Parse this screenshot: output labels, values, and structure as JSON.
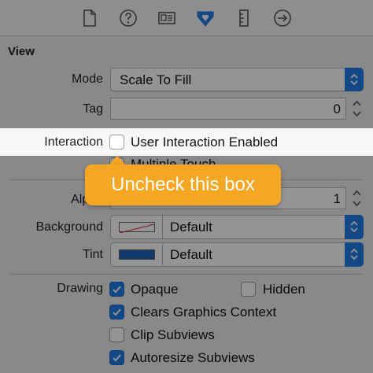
{
  "toolbar": {
    "icons": [
      "file-inspector-icon",
      "help-icon",
      "identity-inspector-icon",
      "attributes-inspector-icon",
      "size-inspector-icon",
      "connections-inspector-icon"
    ],
    "accent": "#1f7de6"
  },
  "view_section": {
    "title": "View",
    "mode": {
      "label": "Mode",
      "value": "Scale To Fill"
    },
    "tag": {
      "label": "Tag",
      "value": "0"
    },
    "interaction": {
      "label": "Interaction",
      "user_interaction": {
        "label": "User Interaction Enabled",
        "checked": false
      },
      "multiple_touch": {
        "label": "Multiple Touch",
        "checked": false
      }
    },
    "alpha": {
      "label": "Alpha",
      "value": "1"
    },
    "background": {
      "label": "Background",
      "value": "Default"
    },
    "tint": {
      "label": "Tint",
      "value": "Default",
      "color": "#1e63b8"
    },
    "drawing": {
      "label": "Drawing",
      "opaque": {
        "label": "Opaque",
        "checked": true
      },
      "hidden": {
        "label": "Hidden",
        "checked": false
      },
      "clears_graphics_context": {
        "label": "Clears Graphics Context",
        "checked": true
      },
      "clip_subviews": {
        "label": "Clip Subviews",
        "checked": false
      },
      "autoresize_subviews": {
        "label": "Autoresize Subviews",
        "checked": true
      }
    }
  },
  "callout": {
    "text": "Uncheck this box",
    "color": "#f5a623"
  }
}
